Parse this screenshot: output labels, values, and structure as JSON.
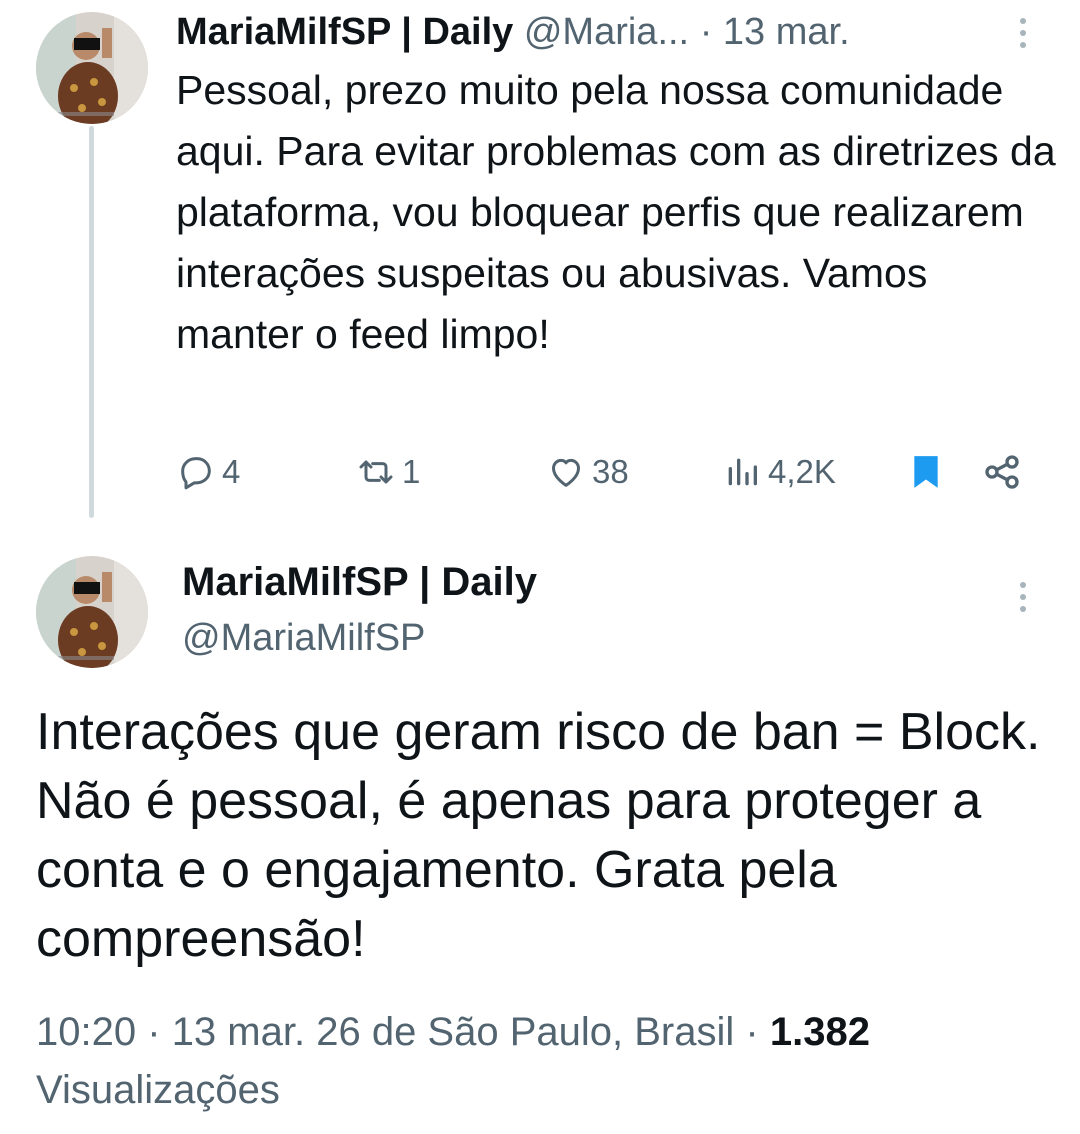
{
  "tweet1": {
    "display_name": "MariaMilfSP | Daily",
    "handle": "@Maria...",
    "separator": "·",
    "date": "13 mar.",
    "text": "Pessoal, prezo muito pela nossa comunidade aqui. Para evitar problemas com as diretrizes da plataforma, vou bloquear perfis que realizarem interações suspeitas ou abusivas. Vamos manter o feed limpo!",
    "actions": {
      "replies": "4",
      "reposts": "1",
      "likes": "38",
      "views": "4,2K"
    },
    "bookmarked": true
  },
  "tweet2": {
    "display_name": "MariaMilfSP | Daily",
    "handle": "@MariaMilfSP",
    "text": "Interações que geram risco de ban = Block. Não é pessoal, é apenas para proteger a conta e o engajamento. Grata pela compreensão!",
    "time": "10:20",
    "separator": "·",
    "date": "13 mar. 26",
    "location": "de São Paulo, Brasil",
    "views_count": "1.382",
    "views_label": "Visualizações"
  },
  "colors": {
    "text": "#0f1419",
    "muted": "#536471",
    "accent": "#1d9bf0",
    "thread_line": "#cfd9de"
  },
  "icons": [
    "reply-icon",
    "repost-icon",
    "like-icon",
    "views-icon",
    "bookmark-icon",
    "share-icon",
    "more-icon"
  ]
}
